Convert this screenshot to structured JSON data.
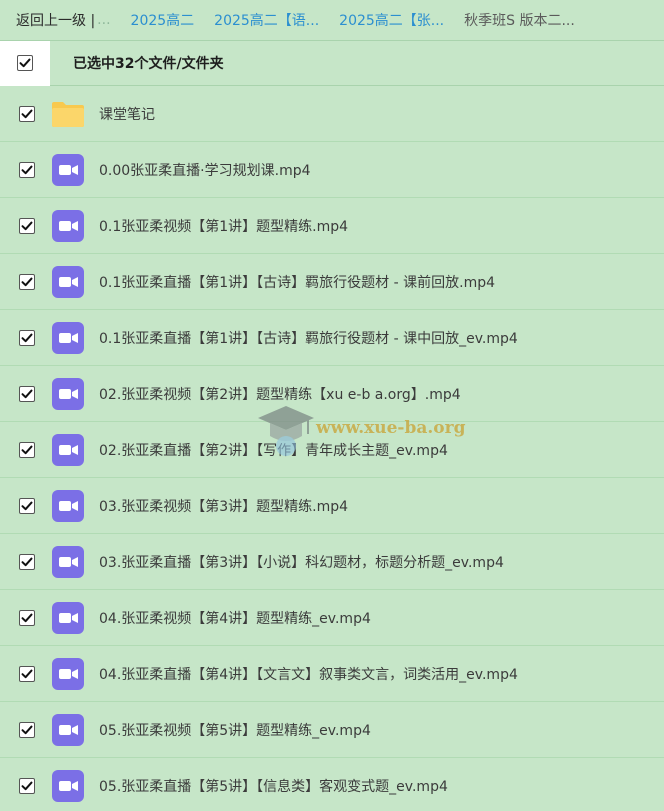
{
  "breadcrumb": {
    "back_label": "返回上一级 |",
    "ellipsis": "...",
    "links": [
      "2025高二",
      "2025高二【语...",
      "2025高二【张..."
    ],
    "current": "秋季班S 版本二..."
  },
  "selection": {
    "label": "已选中32个文件/文件夹",
    "checked": true
  },
  "colors": {
    "page_bg": "#c6e6c8",
    "link": "#2b8fd0",
    "video_icon": "#7b6fe6",
    "folder_icon": "#f8c94f"
  },
  "files": [
    {
      "name": "课堂笔记",
      "type": "folder-icon",
      "checked": true
    },
    {
      "name": "0.00张亚柔直播·学习规划课.mp4",
      "type": "video-icon",
      "checked": true
    },
    {
      "name": "0.1张亚柔视频【第1讲】题型精练.mp4",
      "type": "video-icon",
      "checked": true
    },
    {
      "name": "0.1张亚柔直播【第1讲】【古诗】羁旅行役题材 - 课前回放.mp4",
      "type": "video-icon",
      "checked": true
    },
    {
      "name": "0.1张亚柔直播【第1讲】【古诗】羁旅行役题材 - 课中回放_ev.mp4",
      "type": "video-icon",
      "checked": true
    },
    {
      "name": "02.张亚柔视频【第2讲】题型精练【xu e-b a.org】.mp4",
      "type": "video-icon",
      "checked": true
    },
    {
      "name": "02.张亚柔直播【第2讲】【写作】青年成长主题_ev.mp4",
      "type": "video-icon",
      "checked": true
    },
    {
      "name": "03.张亚柔视频【第3讲】题型精练.mp4",
      "type": "video-icon",
      "checked": true
    },
    {
      "name": "03.张亚柔直播【第3讲】【小说】科幻题材，标题分析题_ev.mp4",
      "type": "video-icon",
      "checked": true
    },
    {
      "name": "04.张亚柔视频【第4讲】题型精练_ev.mp4",
      "type": "video-icon",
      "checked": true
    },
    {
      "name": "04.张亚柔直播【第4讲】【文言文】叙事类文言，词类活用_ev.mp4",
      "type": "video-icon",
      "checked": true
    },
    {
      "name": "05.张亚柔视频【第5讲】题型精练_ev.mp4",
      "type": "video-icon",
      "checked": true
    },
    {
      "name": "05.张亚柔直播【第5讲】【信息类】客观变式题_ev.mp4",
      "type": "video-icon",
      "checked": true
    }
  ],
  "watermark": {
    "text": "www.xue-ba.org"
  }
}
